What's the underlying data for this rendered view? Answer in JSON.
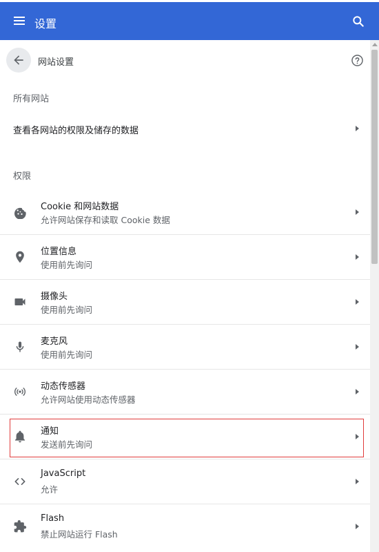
{
  "toolbar": {
    "title": "设置",
    "menu_icon": "menu-icon",
    "search_icon": "search-icon",
    "color": "#3367d6"
  },
  "page": {
    "title": "网站设置",
    "back_icon": "arrow-back-icon",
    "help_icon": "help-icon"
  },
  "all_sites": {
    "section_label": "所有网站",
    "link_label": "查看各网站的权限及储存的数据"
  },
  "permissions": {
    "section_label": "权限",
    "items": [
      {
        "id": "cookies",
        "name": "Cookie 和网站数据",
        "desc": "允许网站保存和读取 Cookie 数据",
        "icon": "cookie-icon"
      },
      {
        "id": "location",
        "name": "位置信息",
        "desc": "使用前先询问",
        "icon": "location-pin-icon"
      },
      {
        "id": "camera",
        "name": "摄像头",
        "desc": "使用前先询问",
        "icon": "camera-icon"
      },
      {
        "id": "microphone",
        "name": "麦克风",
        "desc": "使用前先询问",
        "icon": "microphone-icon"
      },
      {
        "id": "motion-sensors",
        "name": "动态传感器",
        "desc": "允许网站使用动态传感器",
        "icon": "sensors-icon"
      },
      {
        "id": "notifications",
        "name": "通知",
        "desc": "发送前先询问",
        "icon": "bell-icon",
        "highlighted": true
      },
      {
        "id": "javascript",
        "name": "JavaScript",
        "desc": "允许",
        "icon": "code-icon"
      },
      {
        "id": "flash",
        "name": "Flash",
        "desc": "禁止网站运行 Flash",
        "icon": "puzzle-icon"
      }
    ]
  }
}
